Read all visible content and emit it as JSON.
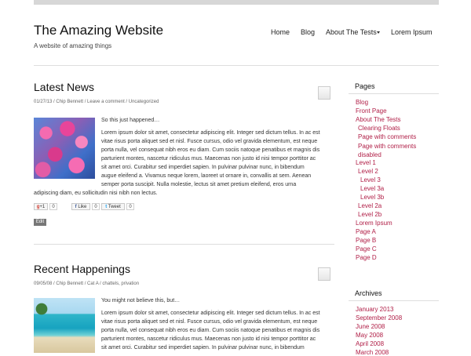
{
  "site": {
    "title": "The Amazing Website",
    "description": "A website of amazing things"
  },
  "nav": {
    "items": [
      "Home",
      "Blog",
      "About The Tests",
      "Lorem Ipsum"
    ]
  },
  "posts": [
    {
      "title": "Latest News",
      "meta": "01/27/13 / Chip Bennett / Leave a comment / Uncategorized",
      "lede": "So this just happened…",
      "lines": [
        "Lorem ipsum dolor sit amet, consectetur adipiscing elit. Integer sed dictum tellus. In ac est",
        "vitae risus porta aliquet sed et nisl. Fusce cursus, odio vel gravida elementum, est neque",
        "porta nulla, vel consequat nibh eros eu diam. Cum sociis natoque penatibus et magnis dis",
        "parturient montes, nascetur ridiculus mus. Maecenas non justo id nisi tempor porttitor ac",
        "sit amet orci. Curabitur sed imperdiet sapien. In pulvinar pulvinar nunc, in bibendum",
        "augue eleifend a. Vivamus neque lorem, laoreet ut ornare in, convallis at sem. Aenean",
        "semper porta suscipit. Nulla molestie, lectus sit amet pretium eleifend, eros urna",
        "adipiscing diam, eu sollicitudin nisi nibh non lectus."
      ],
      "share": {
        "gplus": "+1",
        "gplus_count": "0",
        "like": "Like",
        "like_count": "0",
        "tweet": "Tweet",
        "tweet_count": "0"
      },
      "edit": "Edit"
    },
    {
      "title": "Recent Happenings",
      "meta": "09/05/08 / Chip Bennett / Cat A / chattels, privation",
      "lede": "You might not believe this, but…",
      "lines": [
        "Lorem ipsum dolor sit amet, consectetur adipiscing elit. Integer sed dictum tellus. In ac est",
        "vitae risus porta aliquet sed et nisl. Fusce cursus, odio vel gravida elementum, est neque",
        "porta nulla, vel consequat nibh eros eu diam. Cum sociis natoque penatibus et magnis dis",
        "parturient montes, nascetur ridiculus mus. Maecenas non justo id nisi tempor porttitor ac",
        "sit amet orci. Curabitur sed imperdiet sapien. In pulvinar pulvinar nunc, in bibendum"
      ]
    }
  ],
  "sidebar": {
    "pages_heading": "Pages",
    "pages": [
      "Blog",
      "Front Page",
      "About The Tests",
      "Clearing Floats",
      "Page with comments",
      "Page with comments disabled",
      "Level 1",
      "Level 2",
      "Level 3",
      "Level 3a",
      "Level 3b",
      "Level 2a",
      "Level 2b",
      "Lorem Ipsum",
      "Page A",
      "Page B",
      "Page C",
      "Page D"
    ],
    "archives_heading": "Archives",
    "archives": [
      "January 2013",
      "September 2008",
      "June 2008",
      "May 2008",
      "April 2008",
      "March 2008"
    ]
  },
  "colors": {
    "link": "#b12048",
    "topbar": "#d7d7d7"
  }
}
